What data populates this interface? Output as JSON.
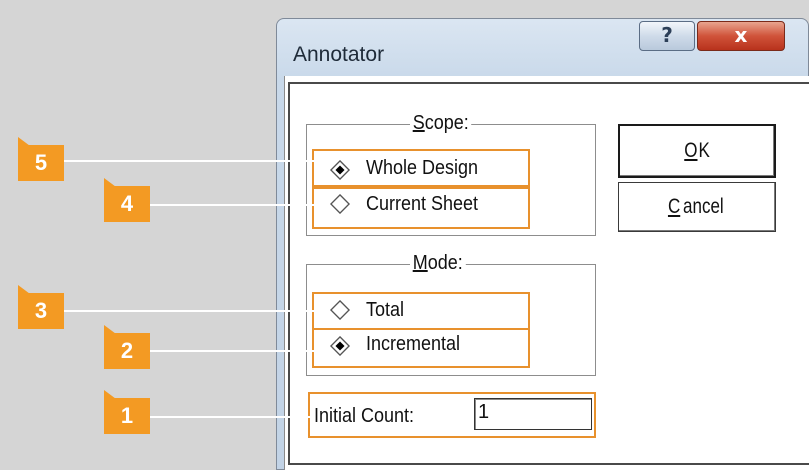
{
  "window": {
    "title": "Annotator",
    "help_glyph": "?",
    "close_glyph": "x"
  },
  "scope": {
    "legend": "Scope:",
    "options": [
      {
        "label": "Whole Design",
        "selected": true
      },
      {
        "label": "Current Sheet",
        "selected": false
      }
    ]
  },
  "mode": {
    "legend": "Mode:",
    "options": [
      {
        "label": "Total",
        "selected": false
      },
      {
        "label": "Incremental",
        "selected": true
      }
    ]
  },
  "initial_count": {
    "label": "Initial Count:",
    "value": "1"
  },
  "buttons": {
    "ok": "OK",
    "cancel": "Cancel"
  },
  "callouts": [
    "5",
    "4",
    "3",
    "2",
    "1"
  ],
  "colors": {
    "callout": "#f39a23",
    "highlight": "#e8912d"
  }
}
